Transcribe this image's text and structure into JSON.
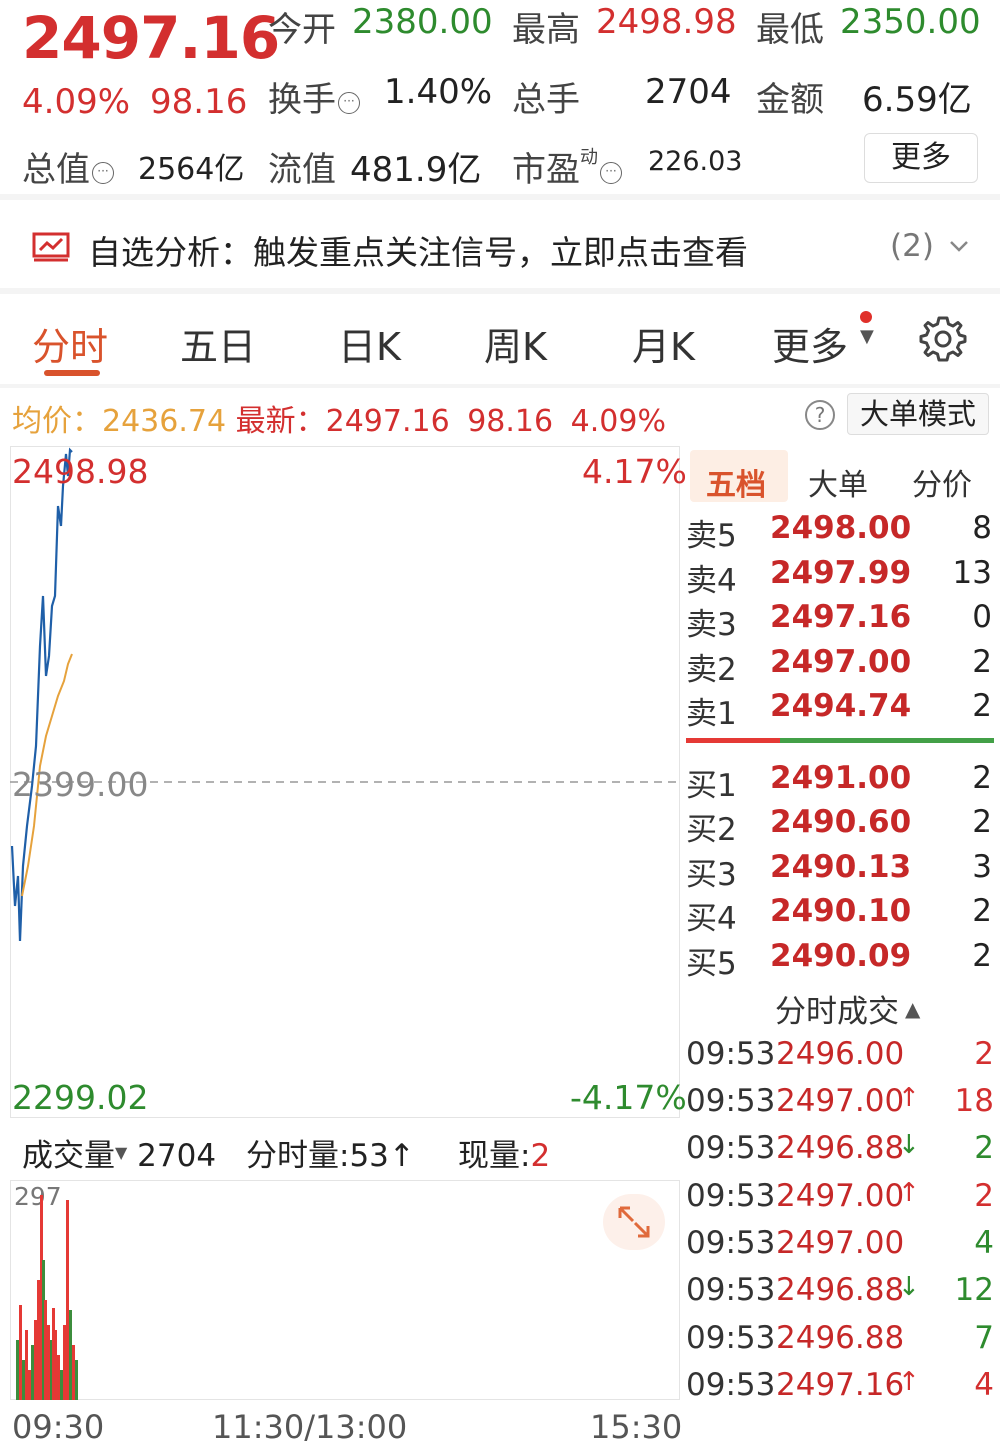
{
  "quote": {
    "price": "2497.16",
    "change_pct": "4.09%",
    "change_amt": "98.16",
    "open_label": "今开",
    "open": "2380.00",
    "high_label": "最高",
    "high": "2498.98",
    "low_label": "最低",
    "low": "2350.00",
    "turnover_label": "换手",
    "turnover": "1.40%",
    "volume_label": "总手",
    "volume": "2704",
    "amount_label": "金额",
    "amount": "6.59亿",
    "mcap_label": "总值",
    "mcap": "2564亿",
    "float_label": "流值",
    "float_cap": "481.9亿",
    "pe_label": "市盈",
    "pe_sup": "动",
    "pe": "226.03",
    "more_button": "更多"
  },
  "analysis_bar": {
    "text": "自选分析：触发重点关注信号，立即点击查看",
    "count": "(2)"
  },
  "tabs": [
    {
      "label": "分时",
      "active": true
    },
    {
      "label": "五日"
    },
    {
      "label": "日K"
    },
    {
      "label": "周K"
    },
    {
      "label": "月K"
    },
    {
      "label": "更多"
    }
  ],
  "price_line": {
    "avg_label": "均价：",
    "avg_value": "2436.74",
    "latest_label": "最新：",
    "latest_value": "2497.16",
    "chg": "98.16",
    "pct": "4.09%",
    "mode_button": "大单模式"
  },
  "chart": {
    "top_price": "2498.98",
    "top_pct": "4.17%",
    "mid_price": "2399.00",
    "bottom_price": "2299.02",
    "bottom_pct": "-4.17%",
    "time_start": "09:30",
    "time_mid": "11:30/13:00",
    "time_end": "15:30"
  },
  "volume_panel": {
    "label": "成交量",
    "total": "2704",
    "minute_label": "分时量:",
    "minute_value": "53",
    "now_label": "现量:",
    "now_value": "2",
    "max_label": "297"
  },
  "colors": {
    "up": "#d32f2f",
    "down": "#2e8b2e",
    "price_line": "#1f5fa8",
    "avg_line": "#e6a23c",
    "accent": "#d9532c"
  },
  "right_tabs": [
    {
      "label": "五档",
      "active": true
    },
    {
      "label": "大单"
    },
    {
      "label": "分价"
    }
  ],
  "asks": [
    {
      "label": "卖5",
      "price": "2498.00",
      "qty": "8"
    },
    {
      "label": "卖4",
      "price": "2497.99",
      "qty": "13"
    },
    {
      "label": "卖3",
      "price": "2497.16",
      "qty": "0"
    },
    {
      "label": "卖2",
      "price": "2497.00",
      "qty": "2"
    },
    {
      "label": "卖1",
      "price": "2494.74",
      "qty": "2"
    }
  ],
  "bids": [
    {
      "label": "买1",
      "price": "2491.00",
      "qty": "2"
    },
    {
      "label": "买2",
      "price": "2490.60",
      "qty": "2"
    },
    {
      "label": "买3",
      "price": "2490.13",
      "qty": "3"
    },
    {
      "label": "买4",
      "price": "2490.10",
      "qty": "2"
    },
    {
      "label": "买5",
      "price": "2490.09",
      "qty": "2"
    }
  ],
  "trades_header": "分时成交",
  "trades": [
    {
      "time": "09:53",
      "price": "2496.00",
      "arrow": "",
      "qty": "2",
      "dir": "up"
    },
    {
      "time": "09:53",
      "price": "2497.00",
      "arrow": "↑",
      "qty": "18",
      "dir": "up"
    },
    {
      "time": "09:53",
      "price": "2496.88",
      "arrow": "↓",
      "qty": "2",
      "dir": "down"
    },
    {
      "time": "09:53",
      "price": "2497.00",
      "arrow": "↑",
      "qty": "2",
      "dir": "up"
    },
    {
      "time": "09:53",
      "price": "2497.00",
      "arrow": "",
      "qty": "4",
      "dir": "down"
    },
    {
      "time": "09:53",
      "price": "2496.88",
      "arrow": "↓",
      "qty": "12",
      "dir": "down"
    },
    {
      "time": "09:53",
      "price": "2496.88",
      "arrow": "",
      "qty": "7",
      "dir": "down"
    },
    {
      "time": "09:53",
      "price": "2497.16",
      "arrow": "↑",
      "qty": "4",
      "dir": "up"
    }
  ]
}
